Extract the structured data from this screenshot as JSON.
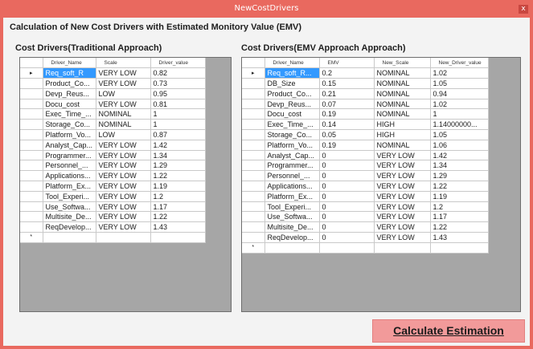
{
  "window": {
    "title": "NewCostDrivers",
    "close_glyph": "x"
  },
  "heading": "Calculation of New Cost Drivers with Estimated Monitory Value (EMV)",
  "left": {
    "title": "Cost Drivers(Traditional Approach)",
    "columns": [
      "Driver_Name",
      "Scale",
      "Driver_value"
    ],
    "current_row_marker": "▸",
    "new_row_marker": "*",
    "rows": [
      [
        "Req_soft_R",
        "VERY LOW",
        "0.82"
      ],
      [
        "Product_Co...",
        "VERY LOW",
        "0.73"
      ],
      [
        "Devp_Reus...",
        "LOW",
        "0.95"
      ],
      [
        "Docu_cost",
        "VERY LOW",
        "0.81"
      ],
      [
        "Exec_Time_...",
        "NOMINAL",
        "1"
      ],
      [
        "Storage_Co...",
        "NOMINAL",
        "1"
      ],
      [
        "Platform_Vo...",
        "LOW",
        "0.87"
      ],
      [
        "Analyst_Cap...",
        "VERY LOW",
        "1.42"
      ],
      [
        "Programmer...",
        "VERY LOW",
        "1.34"
      ],
      [
        "Personnel_...",
        "VERY LOW",
        "1.29"
      ],
      [
        "Applications...",
        "VERY LOW",
        "1.22"
      ],
      [
        "Platform_Ex...",
        "VERY LOW",
        "1.19"
      ],
      [
        "Tool_Experi...",
        "VERY LOW",
        "1.2"
      ],
      [
        "Use_Softwa...",
        "VERY LOW",
        "1.17"
      ],
      [
        "Multisite_De...",
        "VERY LOW",
        "1.22"
      ],
      [
        "ReqDevelop...",
        "VERY LOW",
        "1.43"
      ]
    ]
  },
  "right": {
    "title": "Cost Drivers(EMV Approach Approach)",
    "columns": [
      "Driver_Name",
      "EMV",
      "New_Scale",
      "New_Driver_value"
    ],
    "current_row_marker": "▸",
    "new_row_marker": "*",
    "rows": [
      [
        "Req_soft_R...",
        "0.2",
        "NOMINAL",
        "1.02"
      ],
      [
        "DB_Size",
        "0.15",
        "NOMINAL",
        "1.05"
      ],
      [
        "Product_Co...",
        "0.21",
        "NOMINAL",
        "0.94"
      ],
      [
        "Devp_Reus...",
        "0.07",
        "NOMINAL",
        "1.02"
      ],
      [
        "Docu_cost",
        "0.19",
        "NOMINAL",
        "1"
      ],
      [
        "Exec_Time_...",
        "0.14",
        "HIGH",
        "1.14000000..."
      ],
      [
        "Storage_Co...",
        "0.05",
        "HIGH",
        "1.05"
      ],
      [
        "Platform_Vo...",
        "0.19",
        "NOMINAL",
        "1.06"
      ],
      [
        "Analyst_Cap...",
        "0",
        "VERY LOW",
        "1.42"
      ],
      [
        "Programmer...",
        "0",
        "VERY LOW",
        "1.34"
      ],
      [
        "Personnel_...",
        "0",
        "VERY LOW",
        "1.29"
      ],
      [
        "Applications...",
        "0",
        "VERY LOW",
        "1.22"
      ],
      [
        "Platform_Ex...",
        "0",
        "VERY LOW",
        "1.19"
      ],
      [
        "Tool_Experi...",
        "0",
        "VERY LOW",
        "1.2"
      ],
      [
        "Use_Softwa...",
        "0",
        "VERY LOW",
        "1.17"
      ],
      [
        "Multisite_De...",
        "0",
        "VERY LOW",
        "1.22"
      ],
      [
        "ReqDevelop...",
        "0",
        "VERY LOW",
        "1.43"
      ]
    ]
  },
  "button": {
    "calculate_label": "Calculate Estimation"
  },
  "colors": {
    "titlebar": "#e9695f",
    "selection": "#3399ff",
    "button": "#f29a9a",
    "grid_bg": "#a6a6a6"
  }
}
